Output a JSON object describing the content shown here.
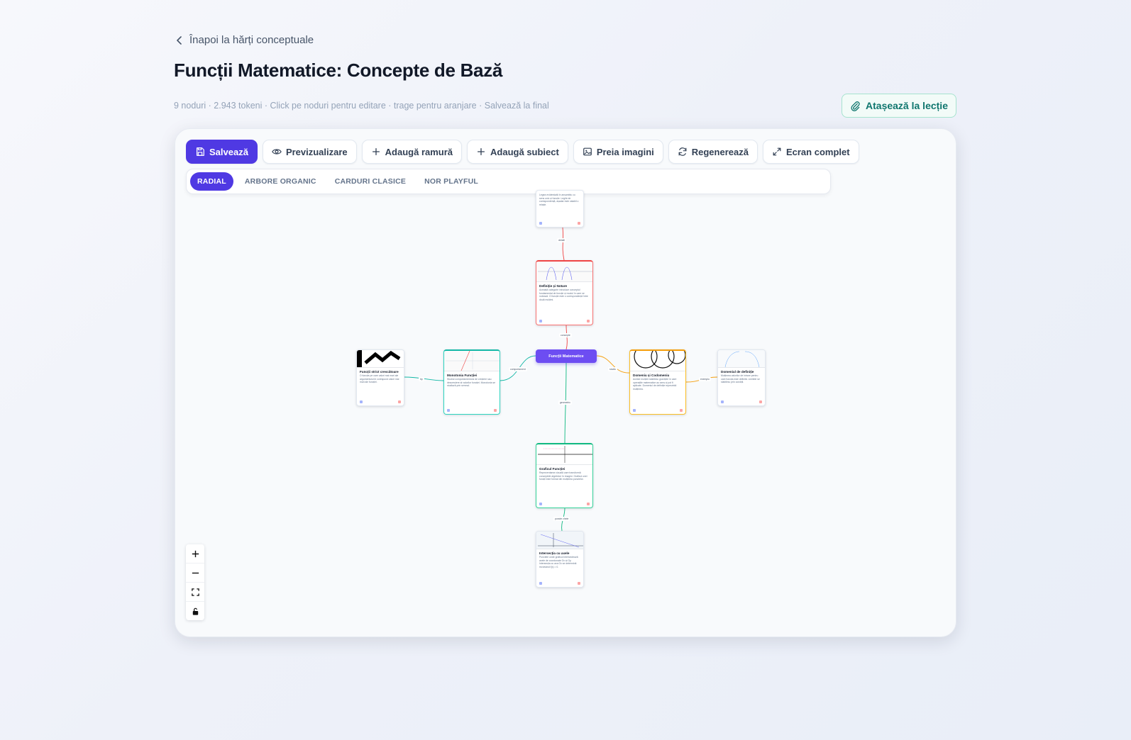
{
  "header": {
    "back_label": "Înapoi la hărți conceptuale",
    "title": "Funcții Matematice: Concepte de Bază",
    "meta": "9 noduri · 2.943 tokeni · Click pe noduri pentru editare · trage pentru aranjare · Salvează la final",
    "attach_label": "Atașează la lecție"
  },
  "toolbar": {
    "save_label": "Salvează",
    "preview_label": "Previzualizare",
    "add_branch_label": "Adaugă ramură",
    "add_subject_label": "Adaugă subiect",
    "images_label": "Preia imagini",
    "regenerate_label": "Regenerează",
    "fullscreen_label": "Ecran complet"
  },
  "layouts": {
    "radial": "RADIAL",
    "organic": "ARBORE ORGANIC",
    "classic": "CARDURI CLASICE",
    "playful": "NOR PLAYFUL",
    "active": "RADIAL"
  },
  "map": {
    "central": "Funcții Matematice",
    "nodes": {
      "top": {
        "title": "",
        "desc": "Legea evidențiată în ansamblu cu sens unic și funcție. Legile de corespondență, așadar este valabil o relație."
      },
      "definitions": {
        "title": "Definiție și Notare",
        "desc": "Această categorie introduce conceptul fundamental de funcție și modul în care se notează. O funcție este o corespondență între două mulțimi."
      },
      "domain": {
        "title": "Domeniu și Codomeniu",
        "desc": "Aceste mulțimi stabilesc granițele în care operațiile matematice au sens și pot fi aplicate. Domeniul de definiție reprezintă mulțimea."
      },
      "domain_def": {
        "title": "Domeniul de definiție",
        "desc": "Mulțimea valorilor de intrare pentru care funcția este definită. Limitele se stabilesc prin condiții."
      },
      "graph": {
        "title": "Graficul Funcției",
        "desc": "Reprezentarea vizuală care transformă conceptele algebrice în imagini. Graficul unei funcții este format din mulțimea punctelor."
      },
      "intersect": {
        "title": "Intersecția cu axele",
        "desc": "Punctele unde graficul intersectează axele de coordonate Ox și Oy. Intersecția cu axa Ox se determină rezolvând f(x) = 0."
      },
      "monotony": {
        "title": "Monotonia Funcției",
        "desc": "Studiul comportamentului de creștere sau descreștere al valorilor funcției. Monotonia se studiază prin semnul."
      },
      "strict": {
        "title": "Funcții strict crescătoare",
        "desc": "O funcție pe care valori mai mari ale argumentului le corespund valori mai mari ale funcției."
      }
    },
    "edge_labels": {
      "top": "detalii",
      "definitions": "concepte",
      "domain": "studiu",
      "domain_def": "exemplu",
      "graph": "geometric",
      "intersect": "puncte cheie",
      "monotony": "comportament",
      "strict": "tip"
    }
  },
  "colors": {
    "primary": "#4f39e3",
    "central": "#6d4df2",
    "red": "#ef4444",
    "orange": "#f59e0b",
    "green": "#10b981",
    "teal": "#14b8a6",
    "attach": "#0f766e"
  },
  "icons": {
    "back": "chevron-left-icon",
    "attach": "paperclip-icon",
    "save": "floppy-disk-icon",
    "preview": "eye-icon",
    "add": "plus-icon",
    "images": "image-icon",
    "regenerate": "refresh-icon",
    "fullscreen": "expand-icon",
    "zoom_in": "plus-icon",
    "zoom_out": "minus-icon",
    "fit": "fit-view-icon",
    "lock": "lock-icon"
  }
}
